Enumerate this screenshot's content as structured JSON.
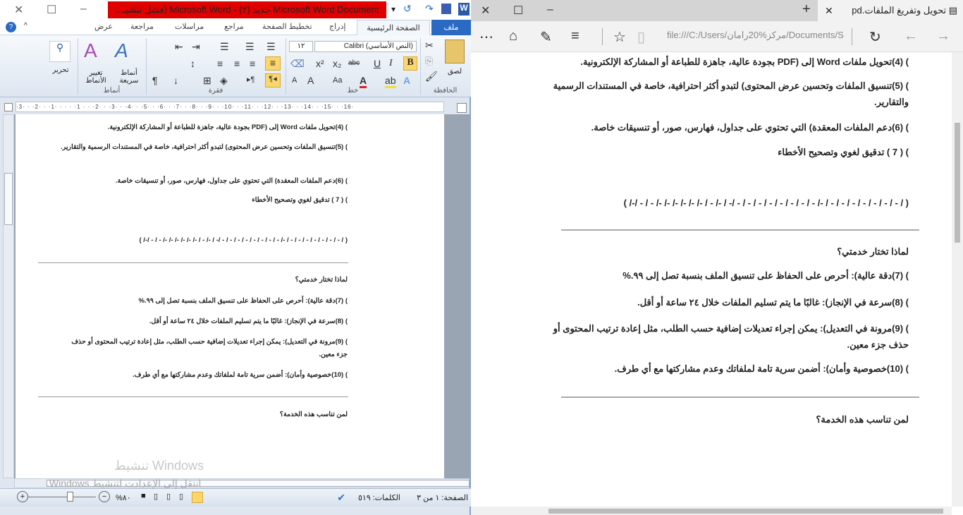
{
  "word": {
    "title": "Microsoft Word Document جديد (٢) - Microsoft Word (فشل تنشيـ...",
    "tabs": [
      "ملف",
      "الصفحة الرئيسية",
      "إدراج",
      "تخطيط الصفحة",
      "مراجع",
      "مراسلات",
      "مراجعة",
      "عرض"
    ],
    "ribbon": {
      "paste": "لصق",
      "clipboard": "الحافظة",
      "font_name": "(النص الأساسي) Calibri",
      "font_size": "١٢",
      "font_group": "خط",
      "paragraph_group": "فقرة",
      "quick_styles": "أنماط سريعة",
      "change_styles": "تغيير الأنماط",
      "styles_group": "أنماط",
      "editing": "تحرير"
    },
    "ruler": "·3· · ·2· · ·1· · · · ·1 · · ·2· · ·3· · ·4· · ·5· · ·6· · ·7· · ·8· · ·9· · ·10· · ·11· · ·12· · ·13· · ·14· · ·15· · ·16·",
    "status": {
      "page": "الصفحة: ١ من ٣",
      "words": "الكلمات: ٥١٩",
      "zoom": "%٨٠"
    },
    "watermark_line1": "تنشيط Windows",
    "watermark_line2": "انتقل إلى الإعدادت لتنشيط Windows."
  },
  "edge": {
    "tab_title": "تحويل وتفريغ الملفات.pd",
    "address": "file:///C:/Users/مركز%20رامان/Documents/S"
  },
  "document": {
    "p1": ") (4)تحويل ملفات Word إلى (PDF بجودة عالية، جاهزة للطباعة أو المشاركة الإلكترونية.",
    "p2": ") (5)تنسيق الملفات وتحسين عرض المحتوى) لتبدو أكثر احترافية، خاصة في المستندات الرسمية والتقارير.",
    "p3": ") (6)دعم الملفات المعقدة) التي تحتوي على جداول، فهارس، صور، أو تنسيقات خاصة.",
    "p4": ") ( 7 )  تدقيق لغوي وتصحيح الأخطاء",
    "dashes": "( / - / - / - / - / - / - / - / -/ - / - / - / - / - / - / - / - /- / -/ - / -/ -/ -/ -/ -/ -/ - / - /-/ )",
    "heading1": "لماذا تختار خدمتي؟",
    "q1": ") (7)دقة عالية): أحرص على الحفاظ على تنسيق الملف بنسبة تصل إلى ٩٩.%",
    "q2": ") (8)سرعة في الإنجاز): غالبًا ما يتم تسليم الملفات خلال ٢٤ ساعة أو أقل.",
    "q3": ") (9)مرونة في التعديل): يمكن إجراء تعديلات إضافية حسب الطلب، مثل إعادة ترتيب المحتوى أو حذف جزء معين.",
    "q4": ") (10)خصوصية وأمان): أضمن سرية تامة لملفاتك وعدم مشاركتها مع أي طرف.",
    "heading2": "لمن تناسب هذه الخدمة؟"
  }
}
